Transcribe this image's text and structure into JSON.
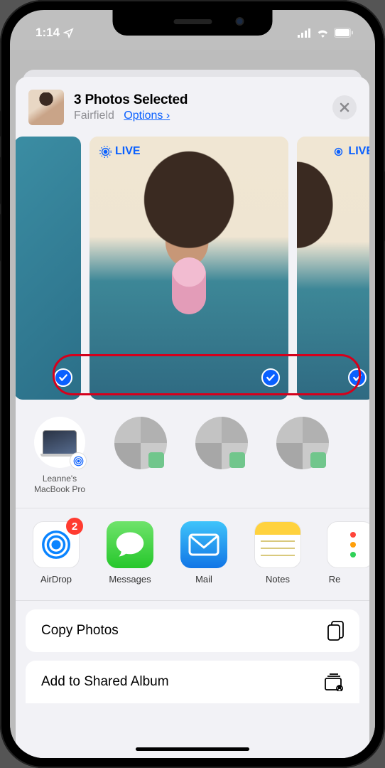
{
  "status": {
    "time": "1:14",
    "location_active": true
  },
  "header": {
    "title": "3 Photos Selected",
    "location": "Fairfield",
    "options_label": "Options"
  },
  "photos": {
    "live_badge": "LIVE",
    "items": [
      {
        "selected": true
      },
      {
        "selected": true,
        "live": true
      },
      {
        "selected": true,
        "live": true
      }
    ]
  },
  "airdrop_contacts": [
    {
      "name": "Leanne's MacBook Pro",
      "type": "device"
    },
    {
      "name": "",
      "type": "blurred"
    },
    {
      "name": "",
      "type": "blurred"
    },
    {
      "name": "",
      "type": "blurred"
    }
  ],
  "apps": [
    {
      "label": "AirDrop",
      "icon": "airdrop",
      "badge": "2"
    },
    {
      "label": "Messages",
      "icon": "messages"
    },
    {
      "label": "Mail",
      "icon": "mail"
    },
    {
      "label": "Notes",
      "icon": "notes"
    },
    {
      "label": "Re",
      "icon": "reminders-cut"
    }
  ],
  "actions": [
    {
      "label": "Copy Photos",
      "icon": "copy"
    },
    {
      "label": "Add to Shared Album",
      "icon": "shared-album"
    }
  ]
}
